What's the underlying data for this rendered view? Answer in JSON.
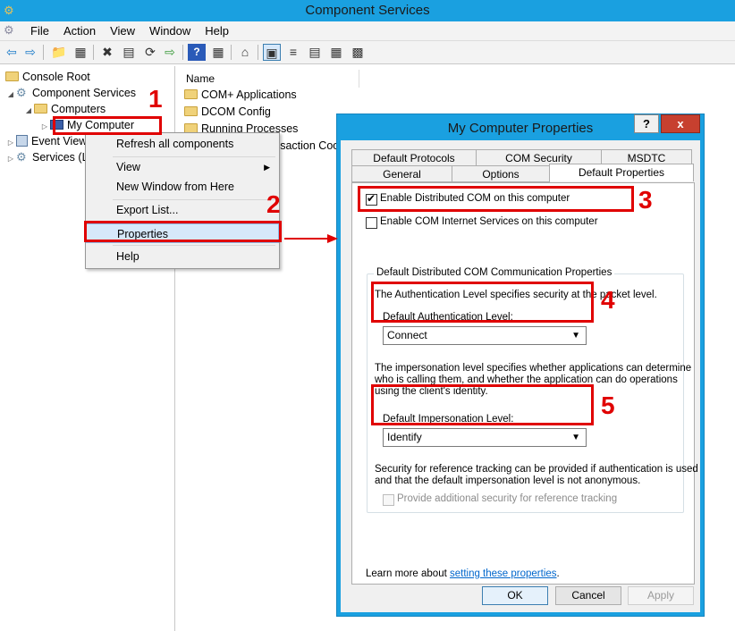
{
  "window": {
    "title": "Component Services"
  },
  "menu": {
    "items": [
      "File",
      "Action",
      "View",
      "Window",
      "Help"
    ]
  },
  "toolbar": {
    "icons": [
      "back-icon",
      "forward-icon",
      "up-folder-icon",
      "show-tree-icon",
      "delete-icon",
      "properties-icon",
      "refresh-icon",
      "export-icon",
      "help-icon",
      "console-icon",
      "install-icon",
      "large-icons-view-icon",
      "list-view-icon",
      "details-view-icon",
      "status-view-icon",
      "grid-view-icon"
    ]
  },
  "tree": {
    "items": [
      {
        "label": "Console Root"
      },
      {
        "label": "Component Services"
      },
      {
        "label": "Computers"
      },
      {
        "label": "My Computer"
      },
      {
        "label": "Event Viewer"
      },
      {
        "label": "Services (Local)"
      }
    ]
  },
  "list": {
    "header": "Name",
    "rows": [
      "COM+ Applications",
      "DCOM Config",
      "Running Processes",
      "Distributed Transaction Coordinator"
    ]
  },
  "context_menu": {
    "items": [
      {
        "label": "Refresh all components"
      },
      {
        "label": "View",
        "has_submenu": true
      },
      {
        "label": "New Window from Here"
      },
      {
        "label": "Export List..."
      },
      {
        "label": "Properties",
        "highlighted": true
      },
      {
        "label": "Help"
      }
    ]
  },
  "annotations": {
    "numbers": [
      "1",
      "2",
      "3",
      "4",
      "5"
    ],
    "color": "#e00000"
  },
  "dialog": {
    "title": "My Computer Properties",
    "help_label": "?",
    "close_label": "x",
    "tabs_row1": [
      "Default Protocols",
      "COM Security",
      "MSDTC"
    ],
    "tabs_row2": [
      "General",
      "Options",
      "Default Properties"
    ],
    "active_tab": "Default Properties",
    "enable_dcom": {
      "label": "Enable Distributed COM on this computer",
      "checked": true
    },
    "enable_cis": {
      "label": "Enable COM Internet Services on this computer",
      "checked": false
    },
    "group_title": "Default Distributed COM Communication Properties",
    "auth_desc": "The Authentication Level specifies security at the packet level.",
    "auth_label": "Default Authentication Level:",
    "auth_value": "Connect",
    "imp_desc": [
      "The impersonation level specifies whether applications can determine",
      "who is calling them, and whether the application can do operations",
      "using the client's identity."
    ],
    "imp_label": "Default Impersonation Level:",
    "imp_value": "Identify",
    "ref_desc": [
      "Security for reference tracking can be provided if authentication is used",
      "and that the default impersonation level is not anonymous."
    ],
    "ref_checkbox": {
      "label": "Provide additional security for reference tracking",
      "checked": false,
      "enabled": false
    },
    "learn_prefix": "Learn more about ",
    "learn_link": "setting these properties",
    "learn_suffix": ".",
    "buttons": {
      "ok": "OK",
      "cancel": "Cancel",
      "apply": "Apply"
    }
  }
}
